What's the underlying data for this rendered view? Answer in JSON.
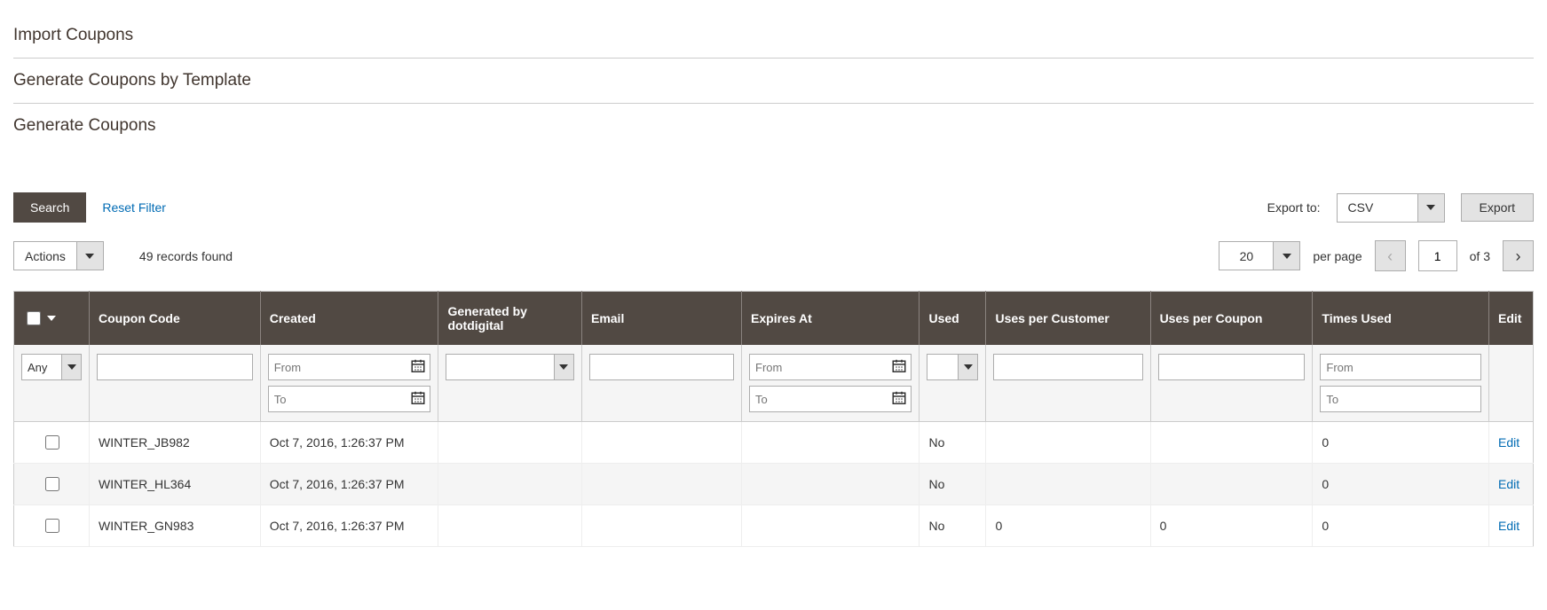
{
  "sections": {
    "import": "Import Coupons",
    "generate_template": "Generate Coupons by Template",
    "generate": "Generate Coupons"
  },
  "toolbar": {
    "search": "Search",
    "reset_filter": "Reset Filter",
    "export_to_label": "Export to:",
    "export_format": "CSV",
    "export_btn": "Export"
  },
  "toolbar2": {
    "actions": "Actions",
    "records_found": "49 records found",
    "per_page_value": "20",
    "per_page_label": "per page",
    "current_page": "1",
    "of_pages": "of 3"
  },
  "columns": {
    "coupon_code": "Coupon Code",
    "created": "Created",
    "generated_by": "Generated by dotdigital",
    "email": "Email",
    "expires_at": "Expires At",
    "used": "Used",
    "uses_per_customer": "Uses per Customer",
    "uses_per_coupon": "Uses per Coupon",
    "times_used": "Times Used",
    "edit": "Edit"
  },
  "filters": {
    "any": "Any",
    "from": "From",
    "to": "To"
  },
  "rows": [
    {
      "code": "WINTER_JB982",
      "created": "Oct 7, 2016, 1:26:37 PM",
      "gen": "",
      "email": "",
      "expires": "",
      "used": "No",
      "upc": "",
      "upcoupon": "",
      "times": "0",
      "edit": "Edit"
    },
    {
      "code": "WINTER_HL364",
      "created": "Oct 7, 2016, 1:26:37 PM",
      "gen": "",
      "email": "",
      "expires": "",
      "used": "No",
      "upc": "",
      "upcoupon": "",
      "times": "0",
      "edit": "Edit"
    },
    {
      "code": "WINTER_GN983",
      "created": "Oct 7, 2016, 1:26:37 PM",
      "gen": "",
      "email": "",
      "expires": "",
      "used": "No",
      "upc": "0",
      "upcoupon": "0",
      "times": "0",
      "edit": "Edit"
    }
  ]
}
